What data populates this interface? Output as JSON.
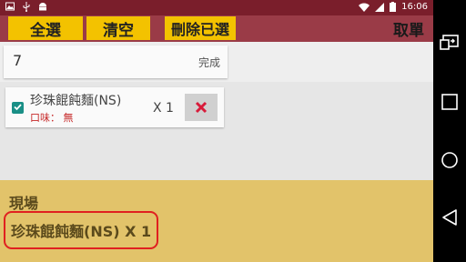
{
  "status_bar": {
    "time": "16:06",
    "left_icons": [
      "image-icon",
      "usb-icon",
      "android-icon"
    ],
    "right_icons": [
      "wifi-icon",
      "signal-icon",
      "battery-icon"
    ]
  },
  "toolbar": {
    "select_all": "全選",
    "clear": "清空",
    "delete_selected": "刪除已選",
    "cancel_order": "取單"
  },
  "quantity": {
    "value": "7",
    "done_label": "完成"
  },
  "order_item": {
    "checked": true,
    "name": "珍珠餛飩麵(NS)",
    "note": "口味： 無",
    "quantity": "X 1",
    "delete_icon": "close-icon"
  },
  "summary": {
    "title": "現場",
    "line": "珍珠餛飩麵(NS) X 1"
  },
  "nav_bar": {
    "buttons": [
      "screen-mirror-icon",
      "recents-icon",
      "home-icon",
      "back-icon"
    ]
  },
  "colors": {
    "status_bar": "#7a1e2b",
    "toolbar": "#9a3b47",
    "button": "#f3c200",
    "summary_bg": "#e2c36a",
    "highlight_border": "#e02020",
    "checkbox": "#1a8f86",
    "delete_x": "#d81b3a"
  }
}
